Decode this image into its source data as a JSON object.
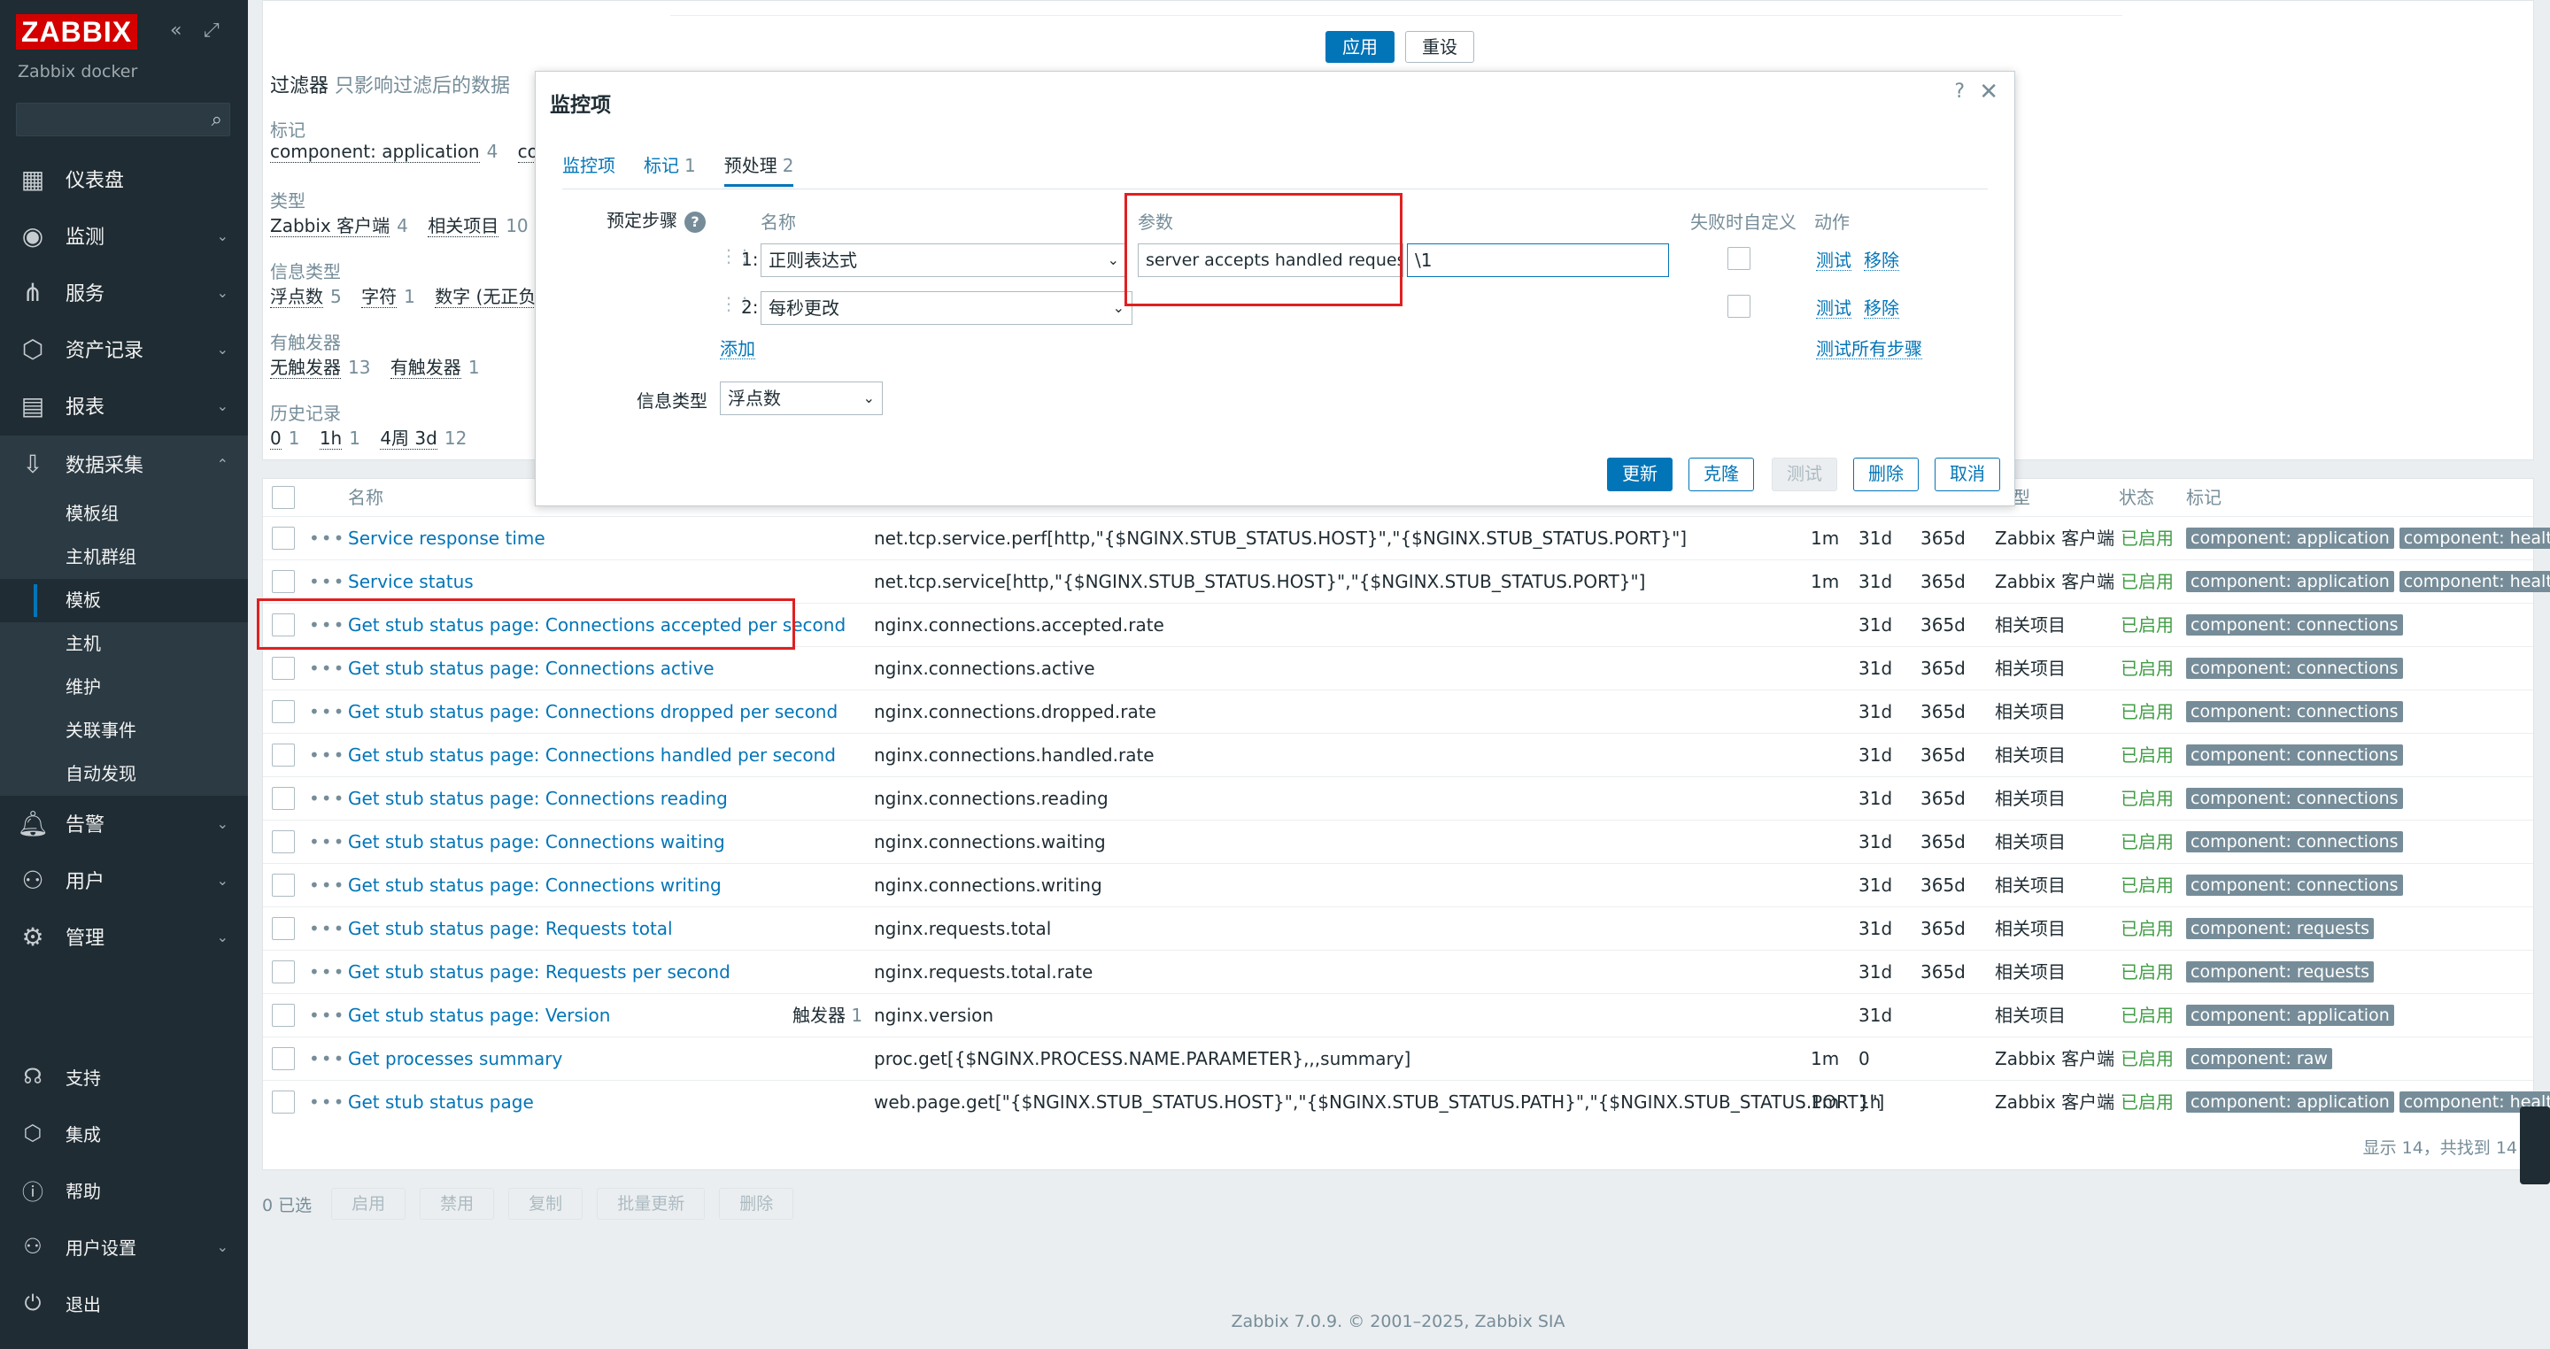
{
  "sidebar": {
    "logo": "ZABBIX",
    "subtitle": "Zabbix docker",
    "menu": [
      {
        "label": "仪表盘",
        "icon": "dashboard-icon"
      },
      {
        "label": "监测",
        "icon": "monitoring-icon"
      },
      {
        "label": "服务",
        "icon": "services-icon"
      },
      {
        "label": "资产记录",
        "icon": "inventory-icon"
      },
      {
        "label": "报表",
        "icon": "reports-icon"
      },
      {
        "label": "数据采集",
        "icon": "data-collection-icon"
      },
      {
        "label": "告警",
        "icon": "alerts-icon"
      },
      {
        "label": "用户",
        "icon": "users-icon"
      },
      {
        "label": "管理",
        "icon": "administration-icon"
      }
    ],
    "submenu": [
      "模板组",
      "主机群组",
      "模板",
      "主机",
      "维护",
      "关联事件",
      "自动发现"
    ],
    "footer": [
      {
        "label": "支持",
        "icon": "support-icon"
      },
      {
        "label": "集成",
        "icon": "integrations-icon"
      },
      {
        "label": "帮助",
        "icon": "help-icon"
      },
      {
        "label": "用户设置",
        "icon": "user-settings-icon"
      },
      {
        "label": "退出",
        "icon": "sign-out-icon"
      }
    ]
  },
  "filter": {
    "apply": "应用",
    "reset": "重设",
    "title": "过滤器",
    "subtitle": "只影响过滤后的数据",
    "tags_label": "标记",
    "tags": [
      {
        "name": "component: application",
        "count": "4"
      },
      {
        "name": "compon",
        "count": ""
      }
    ],
    "type_label": "类型",
    "types": [
      {
        "name": "Zabbix 客户端",
        "count": "4"
      },
      {
        "name": "相关项目",
        "count": "10"
      }
    ],
    "info_label": "信息类型",
    "infos": [
      {
        "name": "浮点数",
        "count": "5"
      },
      {
        "name": "字符",
        "count": "1"
      },
      {
        "name": "数字 (无正负)",
        "count": "6"
      }
    ],
    "trig_label": "有触发器",
    "trigs": [
      {
        "name": "无触发器",
        "count": "13"
      },
      {
        "name": "有触发器",
        "count": "1"
      }
    ],
    "hist_label": "历史记录",
    "hists": [
      {
        "name": "0",
        "count": "1"
      },
      {
        "name": "1h",
        "count": "1"
      },
      {
        "name": "4周 3d",
        "count": "12"
      }
    ]
  },
  "table": {
    "col_name": "名称",
    "col_type_partial": "型",
    "col_status": "状态",
    "col_tags": "标记",
    "rows": [
      {
        "name": "Service response time",
        "prefix": "",
        "trigger": "",
        "trigger_count": "",
        "key": "net.tcp.service.perf[http,\"{$NGINX.STUB_STATUS.HOST}\",\"{$NGINX.STUB_STATUS.PORT}\"]",
        "interval": "1m",
        "history": "31d",
        "trends": "365d",
        "type": "Zabbix 客户端",
        "status": "已启用",
        "tags": [
          "component: application",
          "component: health"
        ]
      },
      {
        "name": "Service status",
        "prefix": "",
        "trigger": "",
        "trigger_count": "",
        "key": "net.tcp.service[http,\"{$NGINX.STUB_STATUS.HOST}\",\"{$NGINX.STUB_STATUS.PORT}\"]",
        "interval": "1m",
        "history": "31d",
        "trends": "365d",
        "type": "Zabbix 客户端",
        "status": "已启用",
        "tags": [
          "component: application",
          "component: health"
        ]
      },
      {
        "name": "Connections accepted per second",
        "prefix": "Get stub status page: ",
        "trigger": "",
        "trigger_count": "",
        "key": "nginx.connections.accepted.rate",
        "interval": "",
        "history": "31d",
        "trends": "365d",
        "type": "相关项目",
        "status": "已启用",
        "tags": [
          "component: connections"
        ]
      },
      {
        "name": "Connections active",
        "prefix": "Get stub status page: ",
        "trigger": "",
        "trigger_count": "",
        "key": "nginx.connections.active",
        "interval": "",
        "history": "31d",
        "trends": "365d",
        "type": "相关项目",
        "status": "已启用",
        "tags": [
          "component: connections"
        ]
      },
      {
        "name": "Connections dropped per second",
        "prefix": "Get stub status page: ",
        "trigger": "",
        "trigger_count": "",
        "key": "nginx.connections.dropped.rate",
        "interval": "",
        "history": "31d",
        "trends": "365d",
        "type": "相关项目",
        "status": "已启用",
        "tags": [
          "component: connections"
        ]
      },
      {
        "name": "Connections handled per second",
        "prefix": "Get stub status page: ",
        "trigger": "",
        "trigger_count": "",
        "key": "nginx.connections.handled.rate",
        "interval": "",
        "history": "31d",
        "trends": "365d",
        "type": "相关项目",
        "status": "已启用",
        "tags": [
          "component: connections"
        ]
      },
      {
        "name": "Connections reading",
        "prefix": "Get stub status page: ",
        "trigger": "",
        "trigger_count": "",
        "key": "nginx.connections.reading",
        "interval": "",
        "history": "31d",
        "trends": "365d",
        "type": "相关项目",
        "status": "已启用",
        "tags": [
          "component: connections"
        ]
      },
      {
        "name": "Connections waiting",
        "prefix": "Get stub status page: ",
        "trigger": "",
        "trigger_count": "",
        "key": "nginx.connections.waiting",
        "interval": "",
        "history": "31d",
        "trends": "365d",
        "type": "相关项目",
        "status": "已启用",
        "tags": [
          "component: connections"
        ]
      },
      {
        "name": "Connections writing",
        "prefix": "Get stub status page: ",
        "trigger": "",
        "trigger_count": "",
        "key": "nginx.connections.writing",
        "interval": "",
        "history": "31d",
        "trends": "365d",
        "type": "相关项目",
        "status": "已启用",
        "tags": [
          "component: connections"
        ]
      },
      {
        "name": "Requests total",
        "prefix": "Get stub status page: ",
        "trigger": "",
        "trigger_count": "",
        "key": "nginx.requests.total",
        "interval": "",
        "history": "31d",
        "trends": "365d",
        "type": "相关项目",
        "status": "已启用",
        "tags": [
          "component: requests"
        ]
      },
      {
        "name": "Requests per second",
        "prefix": "Get stub status page: ",
        "trigger": "",
        "trigger_count": "",
        "key": "nginx.requests.total.rate",
        "interval": "",
        "history": "31d",
        "trends": "365d",
        "type": "相关项目",
        "status": "已启用",
        "tags": [
          "component: requests"
        ]
      },
      {
        "name": "Version",
        "prefix": "Get stub status page: ",
        "trigger": "触发器",
        "trigger_count": "1",
        "key": "nginx.version",
        "interval": "",
        "history": "31d",
        "trends": "",
        "type": "相关项目",
        "status": "已启用",
        "tags": [
          "component: application"
        ]
      },
      {
        "name": "Get processes summary",
        "prefix": "",
        "trigger": "",
        "trigger_count": "",
        "key": "proc.get[{$NGINX.PROCESS.NAME.PARAMETER},,,summary]",
        "interval": "1m",
        "history": "0",
        "trends": "",
        "type": "Zabbix 客户端",
        "status": "已启用",
        "tags": [
          "component: raw"
        ]
      },
      {
        "name": "Get stub status page",
        "prefix": "",
        "trigger": "",
        "trigger_count": "",
        "key": "web.page.get[\"{$NGINX.STUB_STATUS.HOST}\",\"{$NGINX.STUB_STATUS.PATH}\",\"{$NGINX.STUB_STATUS.PORT}\"]",
        "interval": "1m",
        "history": "1h",
        "trends": "",
        "type": "Zabbix 客户端",
        "status": "已启用",
        "tags": [
          "component: application",
          "component: health"
        ]
      }
    ],
    "footer_count": "显示 14，共找到 14"
  },
  "actions": {
    "selected": "0 已选",
    "buttons": [
      "启用",
      "禁用",
      "复制",
      "批量更新",
      "删除"
    ]
  },
  "copyright": "Zabbix 7.0.9. © 2001–2025, Zabbix SIA",
  "modal": {
    "title": "监控项",
    "help": "?",
    "close": "✕",
    "tabs": [
      {
        "label": "监控项",
        "count": ""
      },
      {
        "label": "标记",
        "count": "1"
      },
      {
        "label": "预处理",
        "count": "2"
      }
    ],
    "steps_label": "预定步骤",
    "col_name": "名称",
    "col_params": "参数",
    "col_custom": "失败时自定义",
    "col_actions": "动作",
    "steps": [
      {
        "num": "1:",
        "type": "正则表达式",
        "param1": "server accepts handled requests",
        "param2": "\\1",
        "test": "测试",
        "remove": "移除"
      },
      {
        "num": "2:",
        "type": "每秒更改",
        "param1": "",
        "param2": "",
        "test": "测试",
        "remove": "移除"
      }
    ],
    "add": "添加",
    "test_all": "测试所有步骤",
    "info_type_label": "信息类型",
    "info_type_value": "浮点数",
    "buttons": {
      "update": "更新",
      "clone": "克隆",
      "test": "测试",
      "delete": "删除",
      "cancel": "取消"
    }
  }
}
